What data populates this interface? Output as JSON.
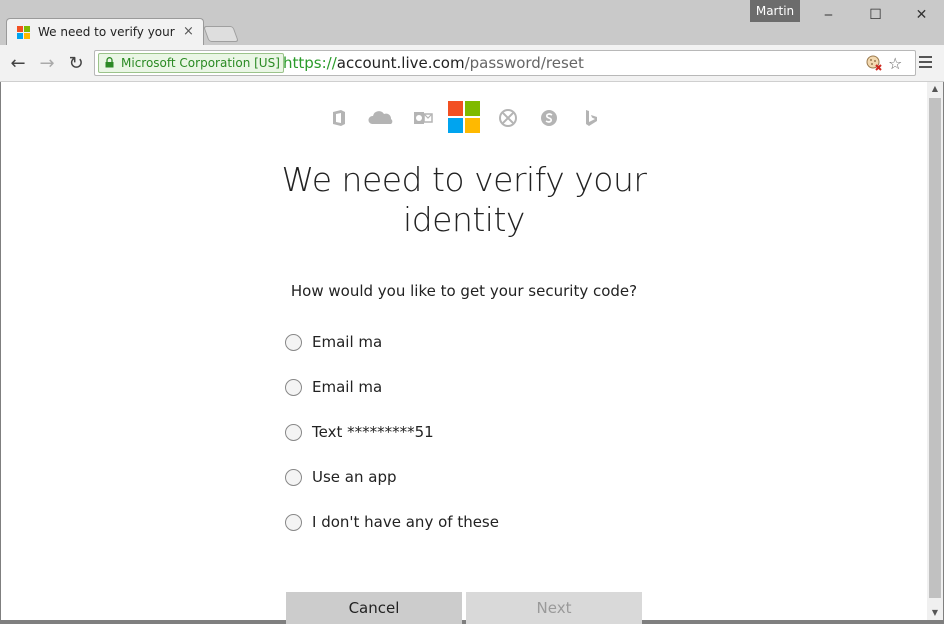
{
  "window": {
    "user_name": "Martin",
    "min_glyph": "‒",
    "max_glyph": "☐",
    "close_glyph": "✕"
  },
  "tab": {
    "title": "We need to verify your identity",
    "close_glyph": "×"
  },
  "toolbar": {
    "back_glyph": "←",
    "forward_glyph": "→",
    "reload_glyph": "↻",
    "ev_label": "Microsoft Corporation [US]",
    "url_scheme": "https://",
    "url_host": "account.live.com",
    "url_path": "/password/reset",
    "star_glyph": "☆"
  },
  "page": {
    "products": [
      "office-icon",
      "onedrive-icon",
      "outlook-icon",
      "microsoft-logo",
      "xbox-icon",
      "skype-icon",
      "bing-icon"
    ],
    "heading_line1": "We need to verify your",
    "heading_line2": "identity",
    "question": "How would you like to get your security code?",
    "options": [
      {
        "label": "Email ma"
      },
      {
        "label": "Email ma"
      },
      {
        "label": "Text *********51"
      },
      {
        "label": "Use an app"
      },
      {
        "label": "I don't have any of these"
      }
    ],
    "cancel_label": "Cancel",
    "next_label": "Next"
  },
  "colors": {
    "ms_red": "#f25022",
    "ms_green": "#7fba00",
    "ms_blue": "#00a4ef",
    "ms_yellow": "#ffb900",
    "ev_green": "#2b8a24"
  }
}
